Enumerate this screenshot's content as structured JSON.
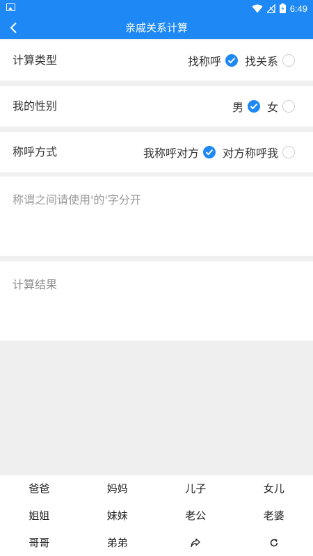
{
  "status_bar": {
    "time": "6:49"
  },
  "app_bar": {
    "title": "亲戚关系计算"
  },
  "calc_type": {
    "label": "计算类型",
    "options": [
      {
        "label": "找称呼",
        "selected": true
      },
      {
        "label": "找关系",
        "selected": false
      }
    ]
  },
  "gender": {
    "label": "我的性别",
    "options": [
      {
        "label": "男",
        "selected": true
      },
      {
        "label": "女",
        "selected": false
      }
    ]
  },
  "address_mode": {
    "label": "称呼方式",
    "options": [
      {
        "label": "我称呼对方",
        "selected": true
      },
      {
        "label": "对方称呼我",
        "selected": false
      }
    ]
  },
  "input": {
    "placeholder": "称谓之间请使用'的'字分开"
  },
  "result": {
    "label": "计算结果"
  },
  "keyboard": {
    "keys": [
      "爸爸",
      "妈妈",
      "儿子",
      "女儿",
      "姐姐",
      "妹妹",
      "老公",
      "老婆",
      "哥哥",
      "弟弟"
    ],
    "extra_icons": [
      "share-icon",
      "refresh-icon"
    ]
  },
  "colors": {
    "accent": "#1e88f5"
  }
}
